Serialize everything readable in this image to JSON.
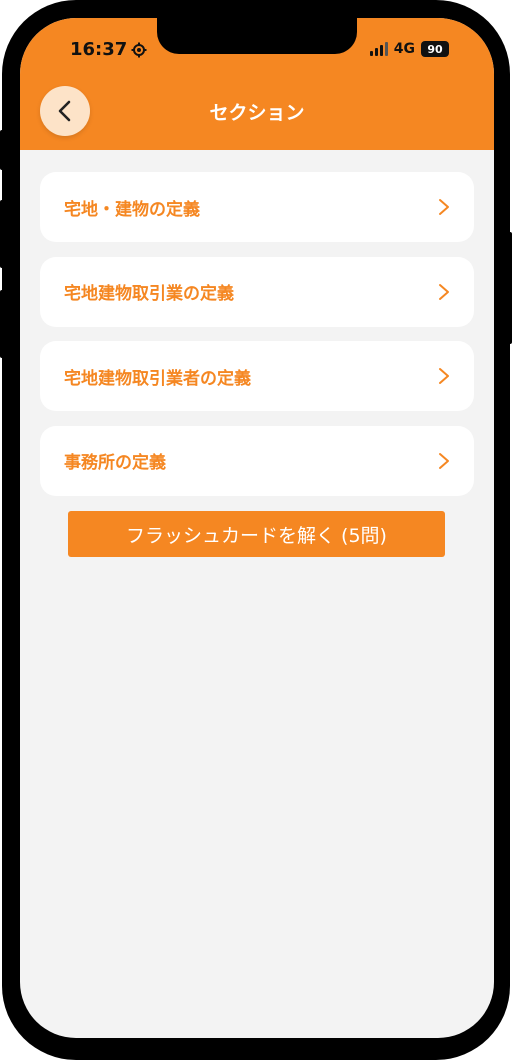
{
  "status_bar": {
    "time": "16:37",
    "network": "4G",
    "battery": "90"
  },
  "header": {
    "title": "セクション",
    "back_icon": "chevron-left-icon"
  },
  "sections": [
    {
      "label": "宅地・建物の定義"
    },
    {
      "label": "宅地建物取引業の定義"
    },
    {
      "label": "宅地建物取引業者の定義"
    },
    {
      "label": "事務所の定義"
    }
  ],
  "flashcard_button": {
    "label": "フラッシュカードを解く (5問)"
  },
  "colors": {
    "accent": "#f58722",
    "background": "#f3f3f3",
    "card": "#ffffff"
  }
}
